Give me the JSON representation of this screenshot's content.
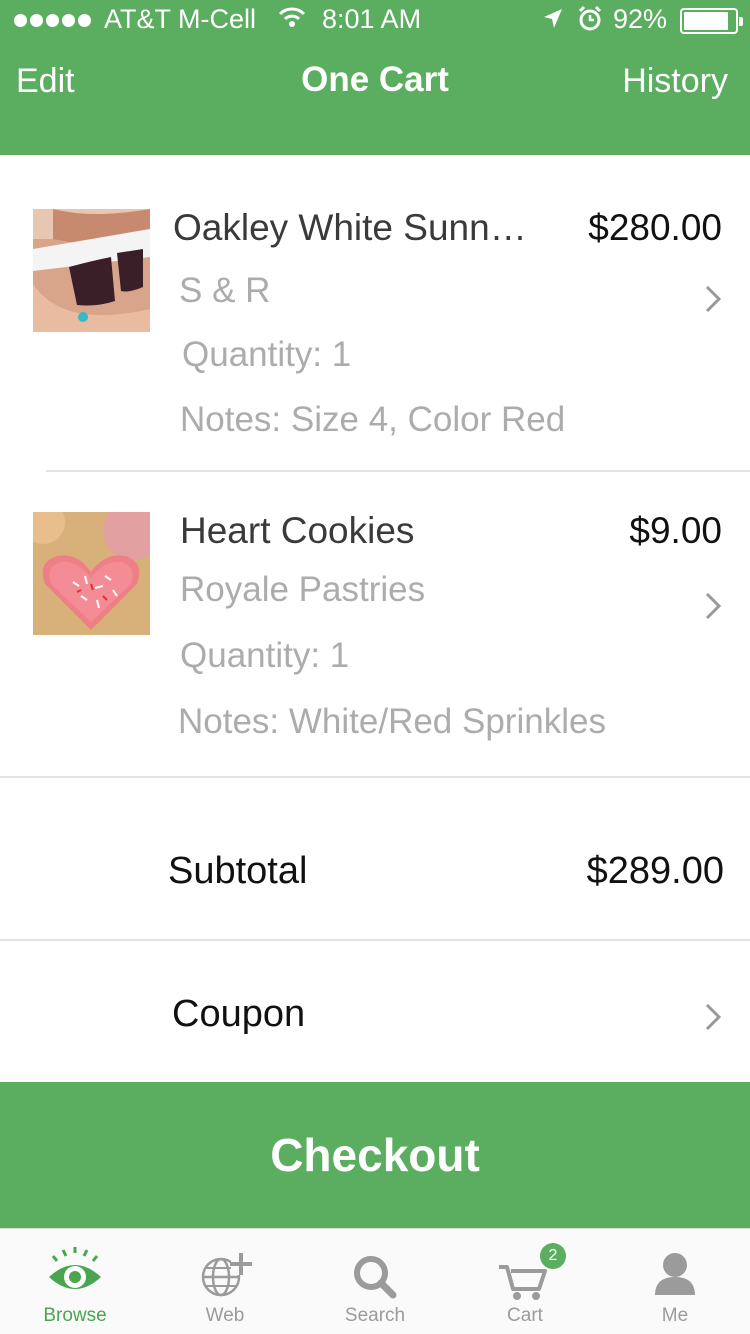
{
  "status": {
    "carrier": "AT&T M-Cell",
    "time": "8:01 AM",
    "battery": "92%",
    "battery_level": 0.92
  },
  "nav": {
    "edit": "Edit",
    "title": "One Cart",
    "history": "History"
  },
  "items": [
    {
      "name": "Oakley White Sunn…",
      "price": "$280.00",
      "store": "S & R",
      "quantity": "Quantity: 1",
      "notes": "Notes: Size 4, Color Red"
    },
    {
      "name": "Heart Cookies",
      "price": "$9.00",
      "store": "Royale Pastries",
      "quantity": "Quantity: 1",
      "notes": "Notes: White/Red Sprinkles"
    }
  ],
  "summary": {
    "subtotal_label": "Subtotal",
    "subtotal_value": "$289.00",
    "coupon_label": "Coupon"
  },
  "checkout_label": "Checkout",
  "tabs": [
    {
      "label": "Browse",
      "icon": "eye-icon",
      "active": true
    },
    {
      "label": "Web",
      "icon": "globe-plus-icon",
      "active": false
    },
    {
      "label": "Search",
      "icon": "magnifier-icon",
      "active": false
    },
    {
      "label": "Cart",
      "icon": "cart-icon",
      "active": false,
      "badge": "2"
    },
    {
      "label": "Me",
      "icon": "person-icon",
      "active": false
    }
  ],
  "colors": {
    "brand_green": "#5bad60",
    "tab_active": "#4aa551",
    "tab_inactive": "#9b9b9b"
  }
}
